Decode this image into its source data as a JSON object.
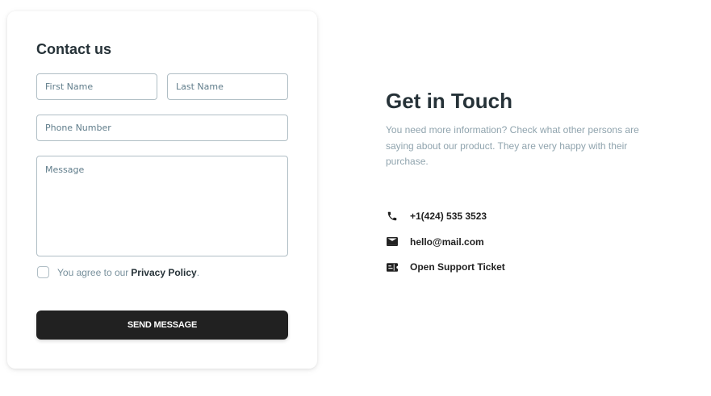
{
  "contact_form": {
    "title": "Contact us",
    "first_name_placeholder": "First Name",
    "last_name_placeholder": "Last Name",
    "phone_placeholder": "Phone Number",
    "message_placeholder": "Message",
    "agree_prefix": "You agree to our",
    "agree_link": "Privacy Policy",
    "agree_suffix": ".",
    "send_label": "SEND MESSAGE"
  },
  "get_in_touch": {
    "title": "Get in Touch",
    "description": "You need more information? Check what other persons are saying about our product. They are very happy with their purchase.",
    "items": [
      {
        "icon": "phone-icon",
        "label": "+1(424) 535 3523"
      },
      {
        "icon": "mail-icon",
        "label": "hello@mail.com"
      },
      {
        "icon": "ticket-icon",
        "label": "Open Support Ticket"
      }
    ]
  }
}
